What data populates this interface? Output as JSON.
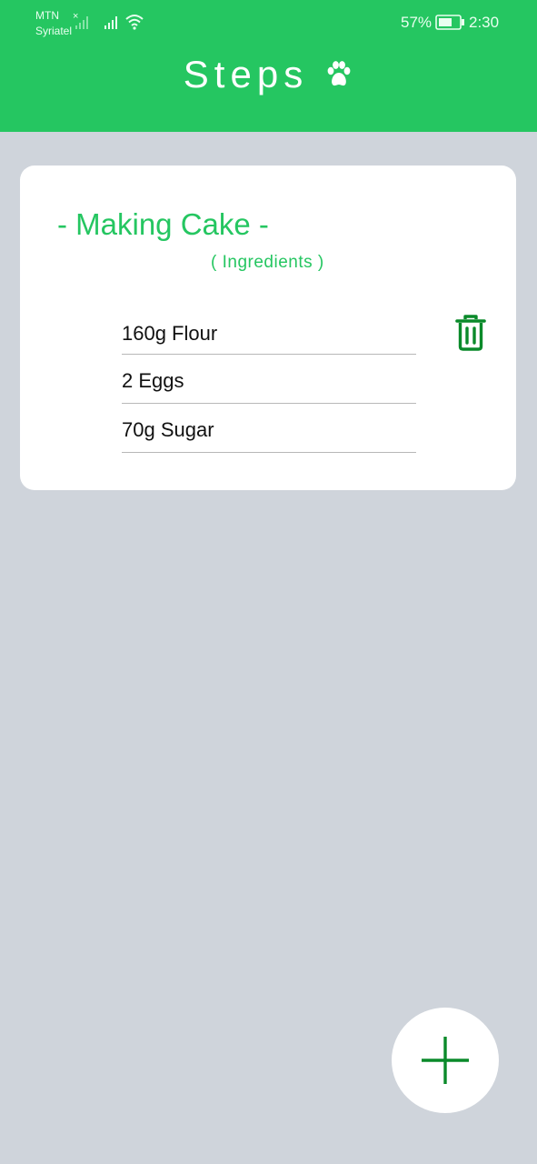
{
  "status_bar": {
    "carrier_1": "MTN",
    "carrier_2": "Syriatel",
    "battery_percent": "57%",
    "time": "2:30"
  },
  "header": {
    "title": "Steps",
    "title_icon": "paw-icon",
    "background_color": "#25c661"
  },
  "card": {
    "title": "- Making Cake -",
    "subtitle": "( Ingredients  )",
    "ingredients": [
      "160g Flour",
      "2 Eggs",
      "70g Sugar"
    ],
    "delete_icon": "trash-icon",
    "accent_color": "#25c661",
    "icon_color": "#0a8a2a"
  },
  "fab": {
    "icon": "plus-icon"
  }
}
